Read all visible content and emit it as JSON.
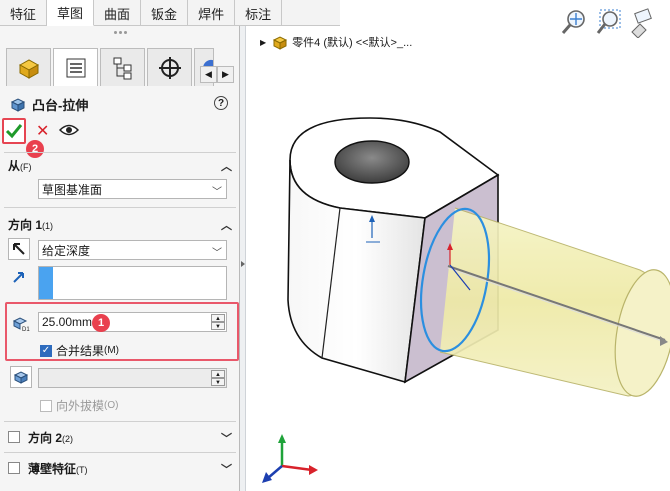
{
  "command_tabs": [
    "特征",
    "草图",
    "曲面",
    "钣金",
    "焊件",
    "标注"
  ],
  "active_command_tab": 1,
  "feature": {
    "title": "凸台-拉伸",
    "help": "?"
  },
  "badges": {
    "one": "1",
    "two": "2"
  },
  "from_section": {
    "label": "从",
    "hotkey": "(F)",
    "value": "草图基准面"
  },
  "direction1": {
    "label": "方向 1",
    "hotkey": "(1)",
    "end_condition": "给定深度",
    "depth": "25.00mm",
    "merge_label": "合并结果",
    "merge_hotkey": "(M)",
    "merge_checked": true,
    "draft_label": "向外拔模",
    "draft_hotkey": "(O)"
  },
  "direction2": {
    "label": "方向 2",
    "hotkey": "(2)"
  },
  "thin_feature": {
    "label": "薄壁特征",
    "hotkey": "(T)"
  },
  "part_tree": {
    "name": "零件4 (默认) <<默认>_..."
  },
  "colors": {
    "accent_red": "#e9404e",
    "selection_blue": "#4aa3f0",
    "preview_yellow": "#f3f0b8",
    "face_purple": "#c9bccd"
  }
}
